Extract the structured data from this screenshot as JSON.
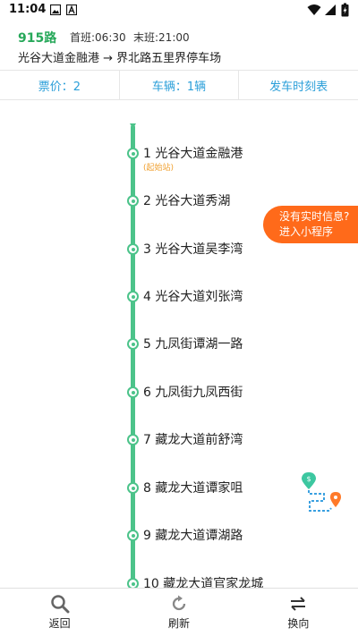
{
  "status_bar": {
    "time": "11:04"
  },
  "route": {
    "name": "915路",
    "first_bus": "首班:06:30",
    "last_bus": "末班:21:00",
    "direction": "光谷大道金融港 → 界北路五里界停车场"
  },
  "info_bar": {
    "fare": "票价：2",
    "vehicles": "车辆：1辆",
    "timetable": "发车时刻表"
  },
  "stops": [
    {
      "label": "1 光谷大道金融港",
      "tag": "(起始站)"
    },
    {
      "label": "2 光谷大道秀湖"
    },
    {
      "label": "3 光谷大道吴李湾"
    },
    {
      "label": "4 光谷大道刘张湾"
    },
    {
      "label": "5 九凤街谭湖一路"
    },
    {
      "label": "6 九凤街九凤西街"
    },
    {
      "label": "7 藏龙大道前舒湾"
    },
    {
      "label": "8 藏龙大道谭家咀"
    },
    {
      "label": "9 藏龙大道谭湖路"
    },
    {
      "label": "10 藏龙大道官家龙城"
    }
  ],
  "mini_program": {
    "line1": "没有实时信息?",
    "line2": "进入小程序"
  },
  "bottom_bar": {
    "back": "返回",
    "refresh": "刷新",
    "reverse": "换向"
  },
  "colors": {
    "accent_green": "#4cc38a",
    "route_green": "#27a85a",
    "link_blue": "#2b9fd9",
    "orange": "#ff6a1a"
  },
  "icons": [
    "image-icon",
    "a-icon",
    "wifi-icon",
    "signal-icon",
    "battery-icon",
    "search-icon",
    "refresh-icon",
    "swap-icon",
    "route-map-icon"
  ]
}
